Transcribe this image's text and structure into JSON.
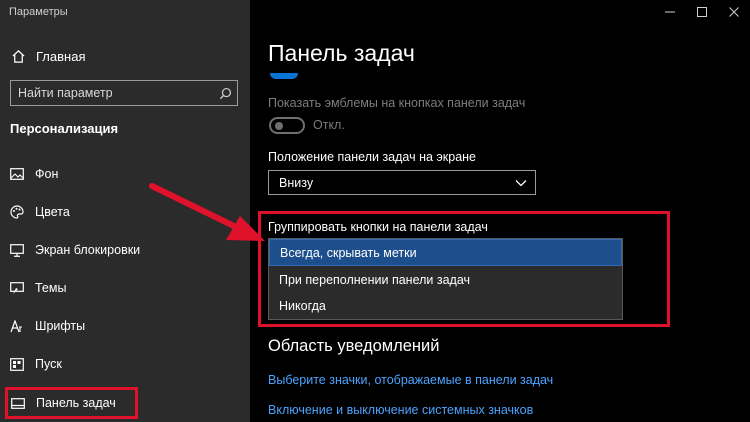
{
  "window": {
    "title": "Параметры",
    "controls": [
      "minimize",
      "maximize",
      "close"
    ]
  },
  "sidebar": {
    "home_label": "Главная",
    "home_icon": "home-icon",
    "search_placeholder": "Найти параметр",
    "section_title": "Персонализация",
    "items": [
      {
        "label": "Фон",
        "icon": "picture-icon"
      },
      {
        "label": "Цвета",
        "icon": "palette-icon"
      },
      {
        "label": "Экран блокировки",
        "icon": "monitor-icon"
      },
      {
        "label": "Темы",
        "icon": "brush-icon"
      },
      {
        "label": "Шрифты",
        "icon": "font-icon"
      },
      {
        "label": "Пуск",
        "icon": "start-icon"
      },
      {
        "label": "Панель задач",
        "icon": "taskbar-icon"
      }
    ]
  },
  "main": {
    "page_title": "Панель задач",
    "badges_setting": {
      "label": "Показать эмблемы на кнопках панели задач",
      "toggle_state": "Откл."
    },
    "position_setting": {
      "label": "Положение панели задач на экране",
      "selected": "Внизу"
    },
    "group_setting": {
      "label": "Группировать кнопки на панели задач",
      "options": [
        "Всегда, скрывать метки",
        "При переполнении панели задач",
        "Никогда"
      ],
      "selected_index": 0
    },
    "notification_area": {
      "title": "Область уведомлений",
      "links": [
        "Выберите значки, отображаемые в панели задач",
        "Включение и выключение системных значков"
      ]
    }
  },
  "colors": {
    "accent": "#0a74d6",
    "highlight_red": "#e0112a",
    "link": "#4aa3ff",
    "selected_option": "#1d4f8c"
  }
}
